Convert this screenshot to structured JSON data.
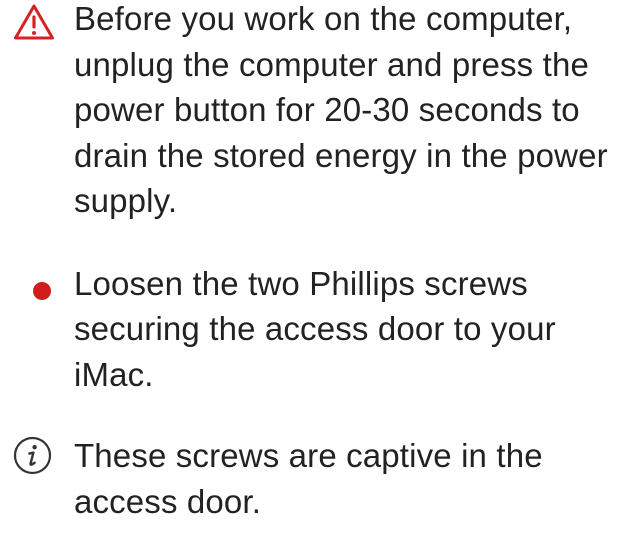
{
  "colors": {
    "text": "#222222",
    "warning": "#d82024",
    "bullet": "#d21c1c",
    "info": "#333333"
  },
  "step": {
    "lines": [
      {
        "kind": "warning",
        "icon": "warning-triangle-icon",
        "text": "Before you work on the computer, unplug the computer and press the power button for 20-30 seconds to drain the stored energy in the power supply."
      },
      {
        "kind": "bullet",
        "icon": "bullet-dot-icon",
        "text": "Loosen the two Phillips screws securing the access door to your iMac."
      },
      {
        "kind": "note",
        "icon": "info-icon",
        "text": "These screws are captive in the access door."
      }
    ]
  }
}
